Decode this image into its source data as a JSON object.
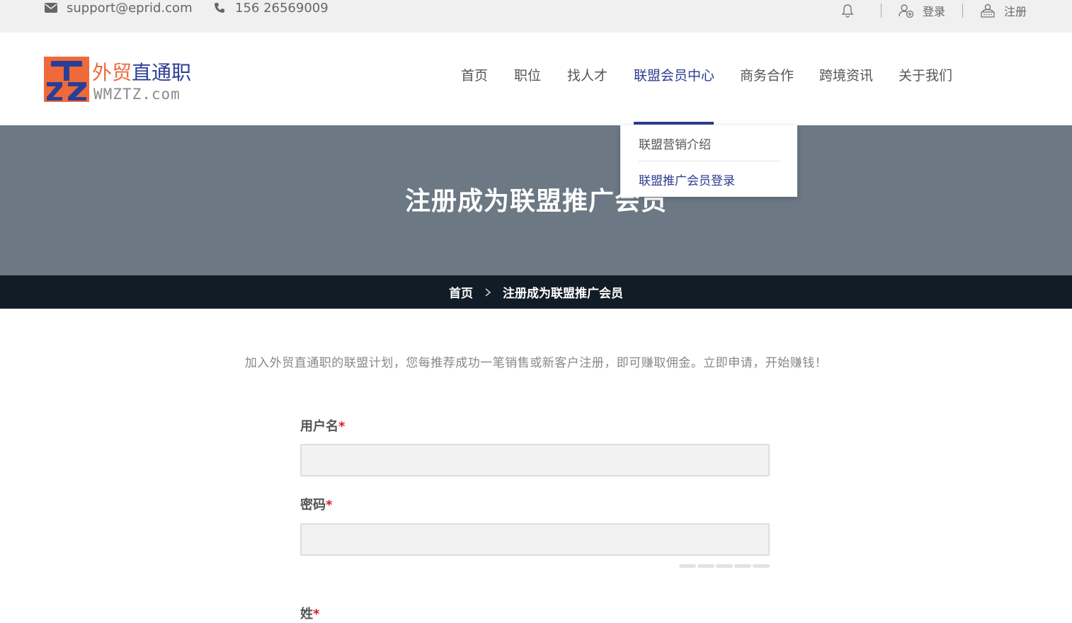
{
  "topbar": {
    "email": "support@eprid.com",
    "phone": "156 26569009",
    "login_label": "登录",
    "register_label": "注册",
    "icons": [
      "envelope-icon",
      "phone-icon",
      "bell-icon",
      "user-plus-icon",
      "register-icon"
    ]
  },
  "logo": {
    "cn_part1": "外贸",
    "cn_part2": "直通职",
    "en": "WMZTZ.com",
    "mark_letters": "TZZ"
  },
  "nav": {
    "items": [
      {
        "label": "首页"
      },
      {
        "label": "职位"
      },
      {
        "label": "找人才"
      },
      {
        "label": "联盟会员中心",
        "active": true
      },
      {
        "label": "商务合作"
      },
      {
        "label": "跨境资讯"
      },
      {
        "label": "关于我们"
      }
    ],
    "dropdown": [
      {
        "label": "联盟营销介绍"
      },
      {
        "label": "联盟推广会员登录",
        "active": true
      }
    ]
  },
  "hero": {
    "title": "注册成为联盟推广会员"
  },
  "breadcrumb": {
    "home": "首页",
    "current": "注册成为联盟推广会员"
  },
  "intro": "加入外贸直通职的联盟计划，您每推荐成功一笔销售或新客户注册，即可赚取佣金。立即申请，开始赚钱！",
  "form": {
    "username_label": "用户名",
    "password_label": "密码",
    "lastname_label": "姓",
    "required_mark": "*",
    "username_value": "",
    "password_value": "",
    "password_strength_segments": 5
  },
  "colors": {
    "accent": "#2d3c8f",
    "logo_orange": "#ef6a3a",
    "hero_bg": "#6c7884",
    "breadcrumb_bg": "#121c27",
    "required": "#d21f2a"
  }
}
